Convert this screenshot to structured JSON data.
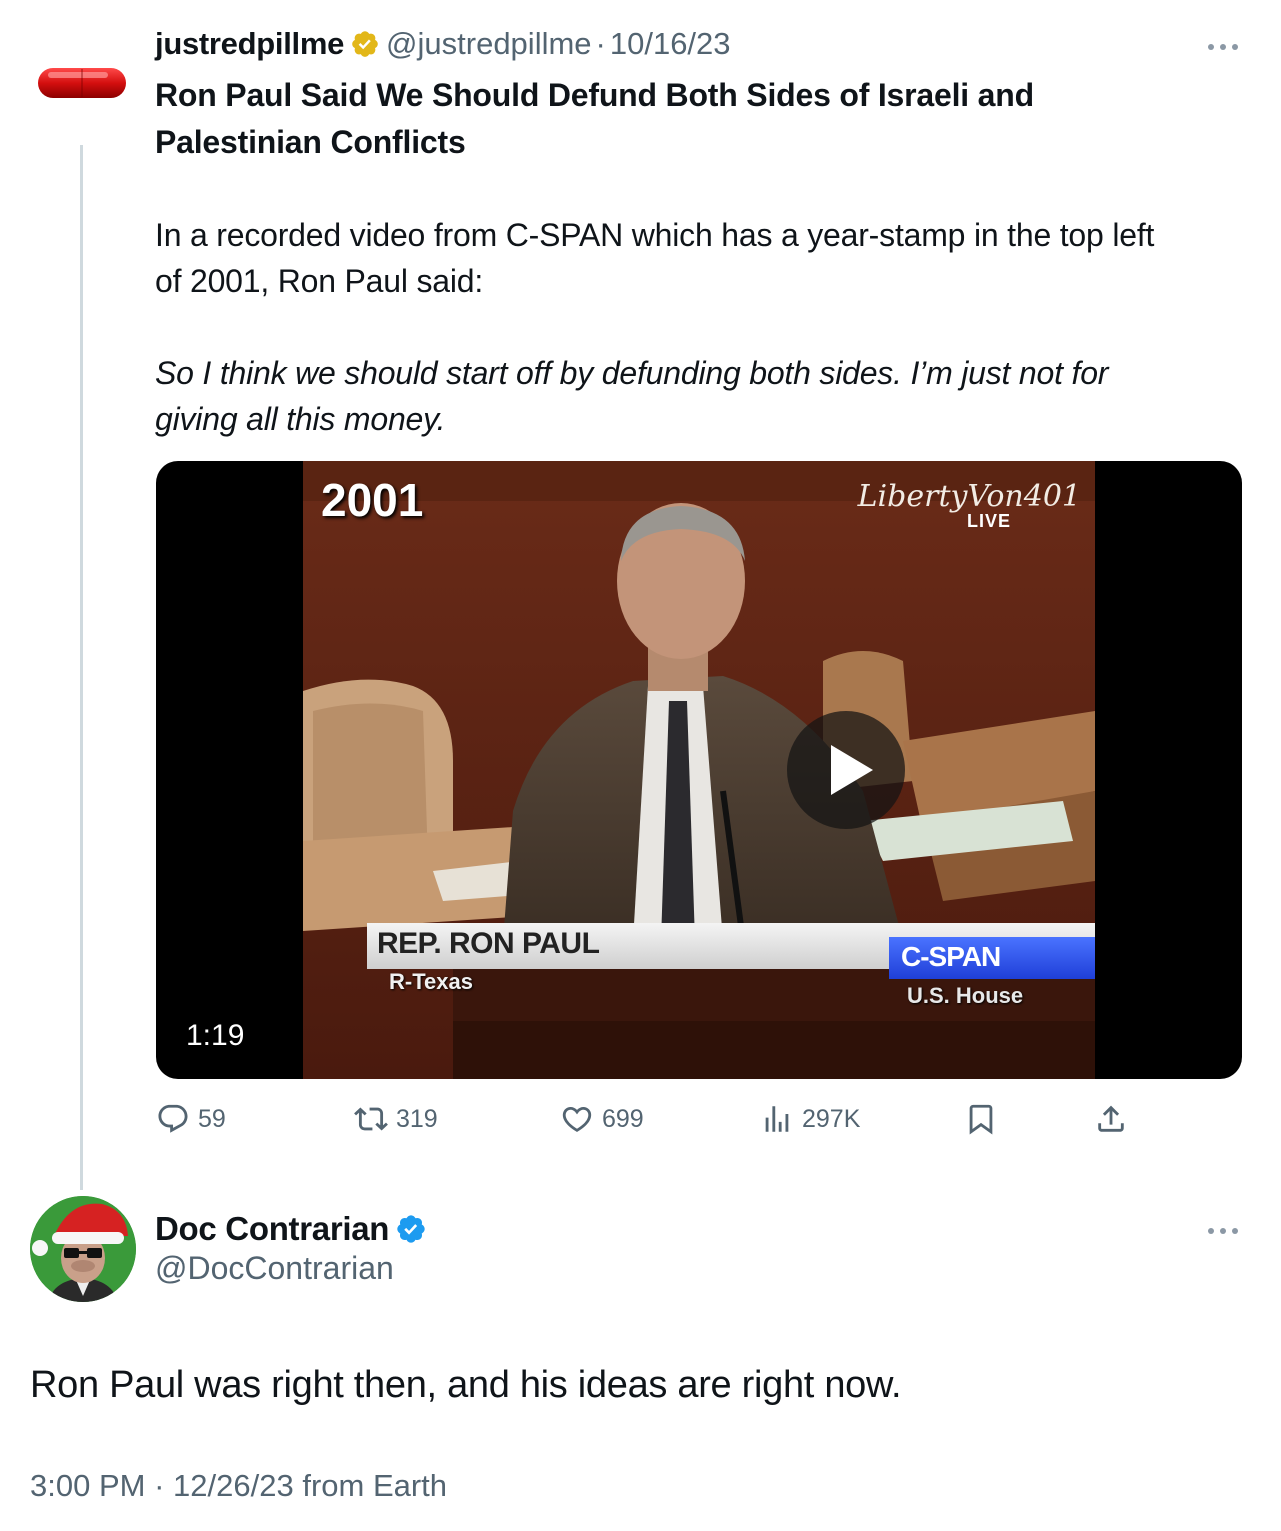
{
  "quoted_tweet": {
    "avatar_icon": "red-pill-icon",
    "display_name": "justredpillme",
    "verified_badge": "gold-verified-icon",
    "handle": "@justredpillme",
    "separator": "·",
    "date": "10/16/23",
    "more_icon": "more-dots-icon",
    "title_line1": "Ron Paul Said We Should Defund Both Sides of Israeli and",
    "title_line2": "Palestinian Conflicts",
    "body_line1": "In a recorded video from C-SPAN which has a year-stamp in the top left",
    "body_line2": "of 2001, Ron Paul said:",
    "quote_line1": "So I think we should start off by defunding both sides. I’m just not for",
    "quote_line2": "giving all this money.",
    "video": {
      "year_stamp": "2001",
      "watermark": "LibertyVon401",
      "live_label": "LIVE",
      "lower_third_name": "REP. RON PAUL",
      "lower_third_sub": "R-Texas",
      "network_logo": "C-SPAN",
      "network_sub": "U.S. House",
      "duration": "1:19",
      "play_icon": "play-icon"
    },
    "actions": {
      "replies": "59",
      "reposts": "319",
      "likes": "699",
      "views": "297K"
    }
  },
  "main_tweet": {
    "display_name": "Doc Contrarian",
    "verified_badge": "blue-verified-icon",
    "handle": "@DocContrarian",
    "text": "Ron Paul was right then, and his ideas are right now.",
    "time": "3:00 PM",
    "separator": "·",
    "date": "12/26/23",
    "source": "from Earth"
  },
  "colors": {
    "text": "#0f1419",
    "secondary": "#536471",
    "thread_line": "#cfd9de",
    "gold_badge": "#e2b719",
    "blue_badge": "#1d9bf0"
  }
}
